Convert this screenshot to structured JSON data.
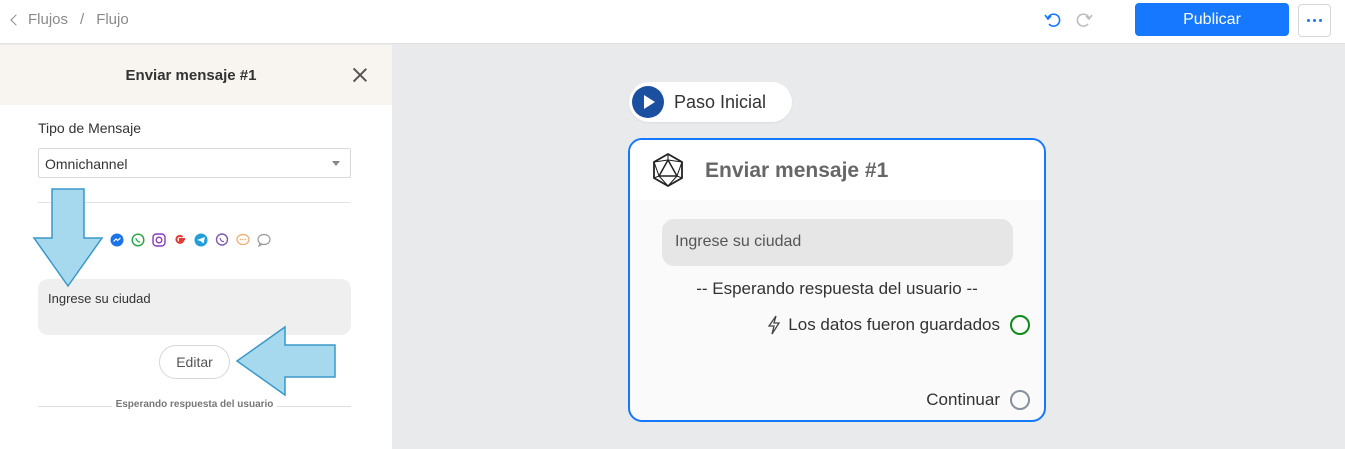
{
  "topbar": {
    "breadcrumb": [
      "Flujos",
      "Flujo"
    ],
    "breadcrumb_sep": "/",
    "publish_label": "Publicar"
  },
  "panel": {
    "title": "Enviar mensaje #1",
    "tipo_label": "Tipo de Mensaje",
    "tipo_value": "Omnichannel",
    "channel_icons": [
      "messenger-icon",
      "whatsapp-icon",
      "instagram-icon",
      "google-icon",
      "telegram-icon",
      "viber-icon",
      "sms-icon",
      "chat-icon"
    ],
    "message_text": "Ingrese su ciudad",
    "edit_label": "Editar",
    "waiting_label": "Esperando respuesta del usuario"
  },
  "canvas": {
    "start_label": "Paso Inicial",
    "card": {
      "title": "Enviar mensaje #1",
      "message_text": "Ingrese su ciudad",
      "waiting_text": "-- Esperando respuesta del usuario --",
      "saved_text": "Los datos fueron guardados",
      "continue_text": "Continuar"
    }
  },
  "colors": {
    "accent": "#1677ff",
    "arrow_fill": "#a6d9ee",
    "arrow_stroke": "#3a98c9",
    "saved_ring": "#0f8a1a",
    "continue_ring": "#888f9c",
    "panel_header": "#f8f4ef"
  }
}
